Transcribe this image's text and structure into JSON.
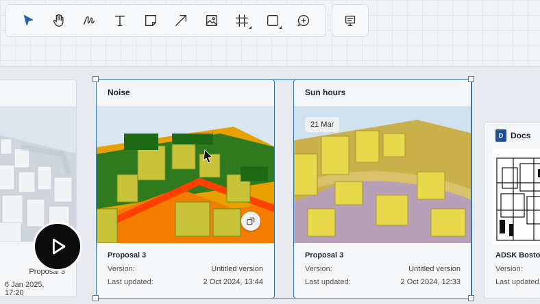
{
  "toolbar": {
    "tools": [
      "select-icon",
      "hand-icon",
      "draw-icon",
      "text-icon",
      "sticky-note-icon",
      "arrow-icon",
      "image-icon",
      "frame-icon",
      "shape-icon",
      "comment-icon"
    ],
    "present_icon": "present-icon"
  },
  "cards": {
    "left": {
      "proposal": "Proposal 3",
      "updated": "6 Jan 2025, 17:20"
    },
    "noise": {
      "title": "Noise",
      "proposal": "Proposal 3",
      "version_label": "Version:",
      "version_value": "Untitled version",
      "updated_label": "Last updated:",
      "updated_value": "2 Oct 2024, 13:44"
    },
    "sun": {
      "title": "Sun hours",
      "date_badge": "21 Mar",
      "proposal": "Proposal 3",
      "version_label": "Version:",
      "version_value": "Untitled version",
      "updated_label": "Last updated:",
      "updated_value": "2 Oct 2024, 12:33"
    },
    "docs": {
      "title": "Docs",
      "logo": "D",
      "name": "ADSK Bosto",
      "version_label": "Version:",
      "updated_label": "Last updated:"
    }
  },
  "colors": {
    "selection": "#2f6fb0",
    "accent": "#1f4e9a"
  }
}
